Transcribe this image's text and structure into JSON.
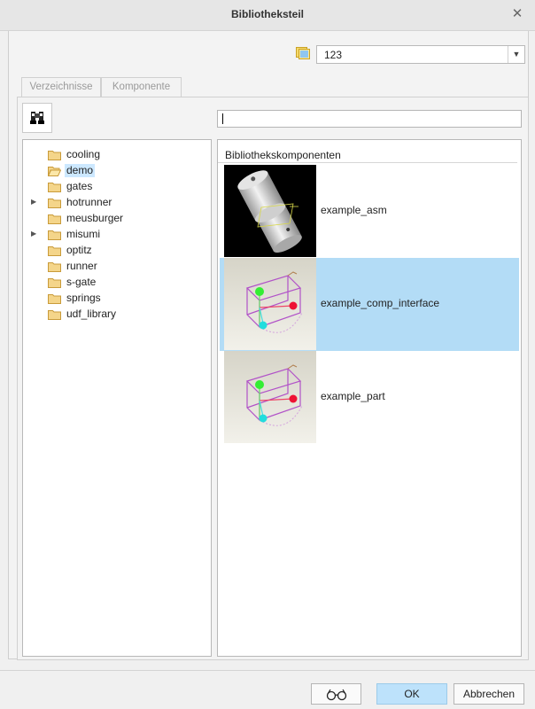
{
  "window": {
    "title": "Bibliotheksteil",
    "close_icon": "close-icon"
  },
  "workspace": {
    "value": "123",
    "icon": "workspace-icon"
  },
  "tabs": [
    {
      "label": "Verzeichnisse"
    },
    {
      "label": "Komponente"
    }
  ],
  "search": {
    "button_icon": "binoculars-icon",
    "value": ""
  },
  "tree": {
    "items": [
      {
        "label": "cooling",
        "expandable": false,
        "open": false,
        "selected": false
      },
      {
        "label": "demo",
        "expandable": false,
        "open": true,
        "selected": true
      },
      {
        "label": "gates",
        "expandable": false,
        "open": false,
        "selected": false
      },
      {
        "label": "hotrunner",
        "expandable": true,
        "open": false,
        "selected": false
      },
      {
        "label": "meusburger",
        "expandable": false,
        "open": false,
        "selected": false
      },
      {
        "label": "misumi",
        "expandable": true,
        "open": false,
        "selected": false
      },
      {
        "label": "optitz",
        "expandable": false,
        "open": false,
        "selected": false
      },
      {
        "label": "runner",
        "expandable": false,
        "open": false,
        "selected": false
      },
      {
        "label": "s-gate",
        "expandable": false,
        "open": false,
        "selected": false
      },
      {
        "label": "springs",
        "expandable": false,
        "open": false,
        "selected": false
      },
      {
        "label": "udf_library",
        "expandable": false,
        "open": false,
        "selected": false
      }
    ]
  },
  "components": {
    "header": "Bibliothekskomponenten",
    "items": [
      {
        "label": "example_asm",
        "thumbnail": "cylinder-assembly-render",
        "selected": false
      },
      {
        "label": "example_comp_interface",
        "thumbnail": "wireframe-box-render",
        "selected": true
      },
      {
        "label": "example_part",
        "thumbnail": "wireframe-box-render",
        "selected": false
      }
    ]
  },
  "buttons": {
    "preview_icon": "glasses-icon",
    "ok": "OK",
    "cancel": "Abbrechen"
  },
  "colors": {
    "selection": "#b3dcf6",
    "tree_selection": "#cce8ff",
    "ok_button": "#bde2fb",
    "folder": "#e8c46a"
  }
}
